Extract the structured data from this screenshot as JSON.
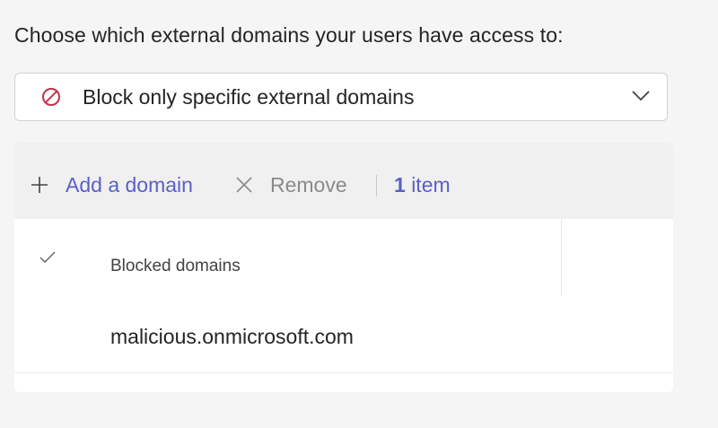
{
  "prompt": "Choose which external domains your users have access to:",
  "dropdown": {
    "selected": "Block only specific external domains",
    "icon": "block-icon",
    "block_color": "#c4314b"
  },
  "toolbar": {
    "add_label": "Add a domain",
    "remove_label": "Remove",
    "count_number": "1",
    "count_suffix": "item"
  },
  "table": {
    "column_header": "Blocked domains",
    "rows": [
      "malicious.onmicrosoft.com"
    ]
  },
  "colors": {
    "accent": "#5b5fc7",
    "disabled": "#8a8a8a"
  }
}
